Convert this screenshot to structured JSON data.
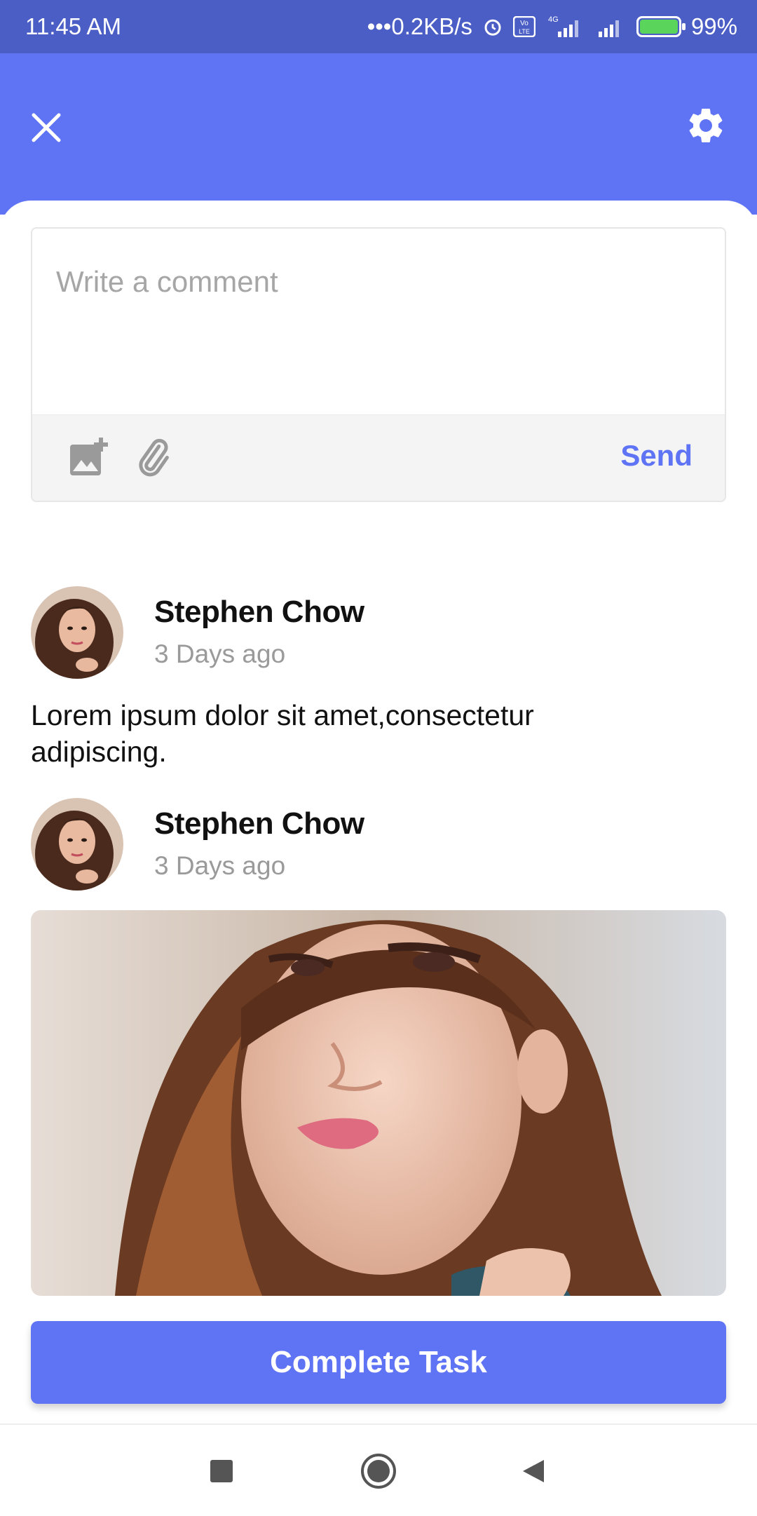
{
  "status_bar": {
    "time": "11:45 AM",
    "network_speed": "0.2KB/s",
    "network_type": "4G",
    "volte": "Vo LTE",
    "battery": "99%"
  },
  "header": {
    "close_icon": "close-icon",
    "settings_icon": "gear-icon"
  },
  "composer": {
    "placeholder": "Write a comment",
    "value": "",
    "send_label": "Send"
  },
  "posts": [
    {
      "author": "Stephen Chow",
      "time": "3 Days ago",
      "text": "Lorem ipsum dolor sit amet,consectetur adipiscing."
    },
    {
      "author": "Stephen Chow",
      "time": "3 Days ago",
      "text": ""
    }
  ],
  "footer": {
    "complete_label": "Complete Task"
  },
  "colors": {
    "status_bar": "#4b5ec6",
    "accent": "#5f73f5",
    "placeholder": "#a6a6a6",
    "muted": "#9a9a9a"
  }
}
